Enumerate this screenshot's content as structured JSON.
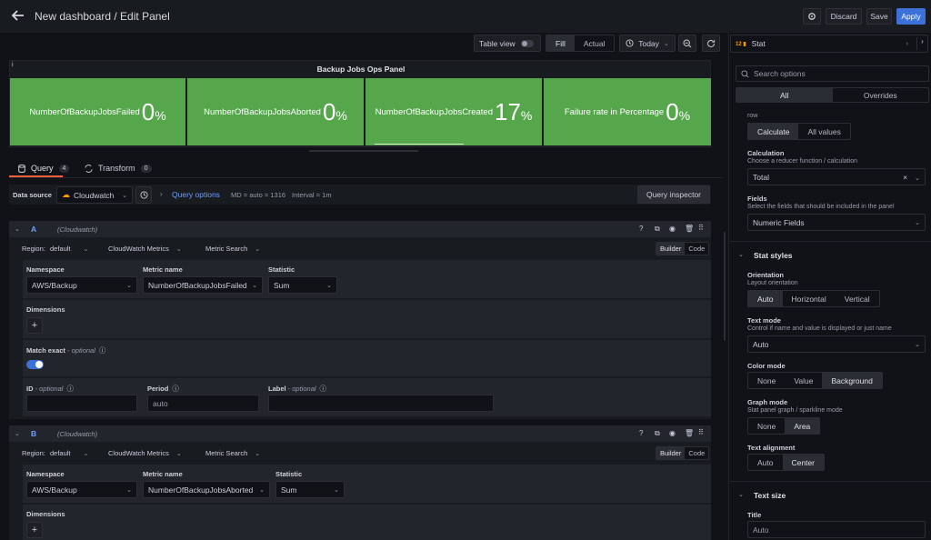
{
  "header": {
    "title": "New dashboard / Edit Panel",
    "discard": "Discard",
    "save": "Save",
    "apply": "Apply"
  },
  "toolbar": {
    "table_view": "Table view",
    "fill": "Fill",
    "actual": "Actual",
    "time": "Today"
  },
  "panel": {
    "title": "Backup Jobs Ops Panel",
    "info": "i",
    "stats": [
      {
        "name": "NumberOfBackupJobsFailed",
        "value": "0",
        "unit": "%"
      },
      {
        "name": "NumberOfBackupJobsAborted",
        "value": "0",
        "unit": "%"
      },
      {
        "name": "NumberOfBackupJobsCreated",
        "value": "17",
        "unit": "%"
      },
      {
        "name": "Failure rate in Percentage",
        "value": "0",
        "unit": "%"
      }
    ]
  },
  "tabs": {
    "query": "Query",
    "query_count": "4",
    "transform": "Transform",
    "transform_count": "0"
  },
  "datasource": {
    "label": "Data source",
    "value": "Cloudwatch",
    "query_options": "Query options",
    "md": "MD = auto = 1316",
    "interval": "Interval = 1m",
    "inspector": "Query inspector"
  },
  "queries": [
    {
      "id": "A",
      "source": "(Cloudwatch)",
      "region_label": "Region:",
      "region": "default",
      "api": "CloudWatch Metrics",
      "mode": "Metric Search",
      "builder": "Builder",
      "code": "Code",
      "namespace_label": "Namespace",
      "namespace": "AWS/Backup",
      "metric_label": "Metric name",
      "metric": "NumberOfBackupJobsFailed",
      "stat_label": "Statistic",
      "stat": "Sum",
      "dims": "Dimensions",
      "match_label": "Match exact",
      "optional": " - optional",
      "id_label": "ID",
      "period_label": "Period",
      "period": "auto",
      "label_label": "Label"
    },
    {
      "id": "B",
      "source": "(Cloudwatch)",
      "region_label": "Region:",
      "region": "default",
      "api": "CloudWatch Metrics",
      "mode": "Metric Search",
      "builder": "Builder",
      "code": "Code",
      "namespace_label": "Namespace",
      "namespace": "AWS/Backup",
      "metric_label": "Metric name",
      "metric": "NumberOfBackupJobsAborted",
      "stat_label": "Statistic",
      "stat": "Sum",
      "dims": "Dimensions"
    }
  ],
  "options": {
    "viz": "Stat",
    "search_placeholder": "Search options",
    "all": "All",
    "overrides": "Overrides",
    "row": "row",
    "calculate": "Calculate",
    "all_values": "All values",
    "calc_label": "Calculation",
    "calc_desc": "Choose a reducer function / calculation",
    "calc_value": "Total",
    "fields_label": "Fields",
    "fields_desc": "Select the fields that should be included in the panel",
    "fields_value": "Numeric Fields",
    "stat_styles": "Stat styles",
    "orient_label": "Orientation",
    "orient_desc": "Layout orientation",
    "orient": [
      "Auto",
      "Horizontal",
      "Vertical"
    ],
    "textmode_label": "Text mode",
    "textmode_desc": "Control if name and value is displayed or just name",
    "textmode_value": "Auto",
    "color_label": "Color mode",
    "color": [
      "None",
      "Value",
      "Background"
    ],
    "graph_label": "Graph mode",
    "graph_desc": "Stat panel graph / sparkline mode",
    "graph": [
      "None",
      "Area"
    ],
    "align_label": "Text alignment",
    "align": [
      "Auto",
      "Center"
    ],
    "text_size": "Text size",
    "title_label": "Title",
    "title_placeholder": "Auto"
  },
  "colors": {
    "stat_bg": "#56a64b",
    "accent": "#3d71d9",
    "tab_underline": "#f55f3e"
  }
}
